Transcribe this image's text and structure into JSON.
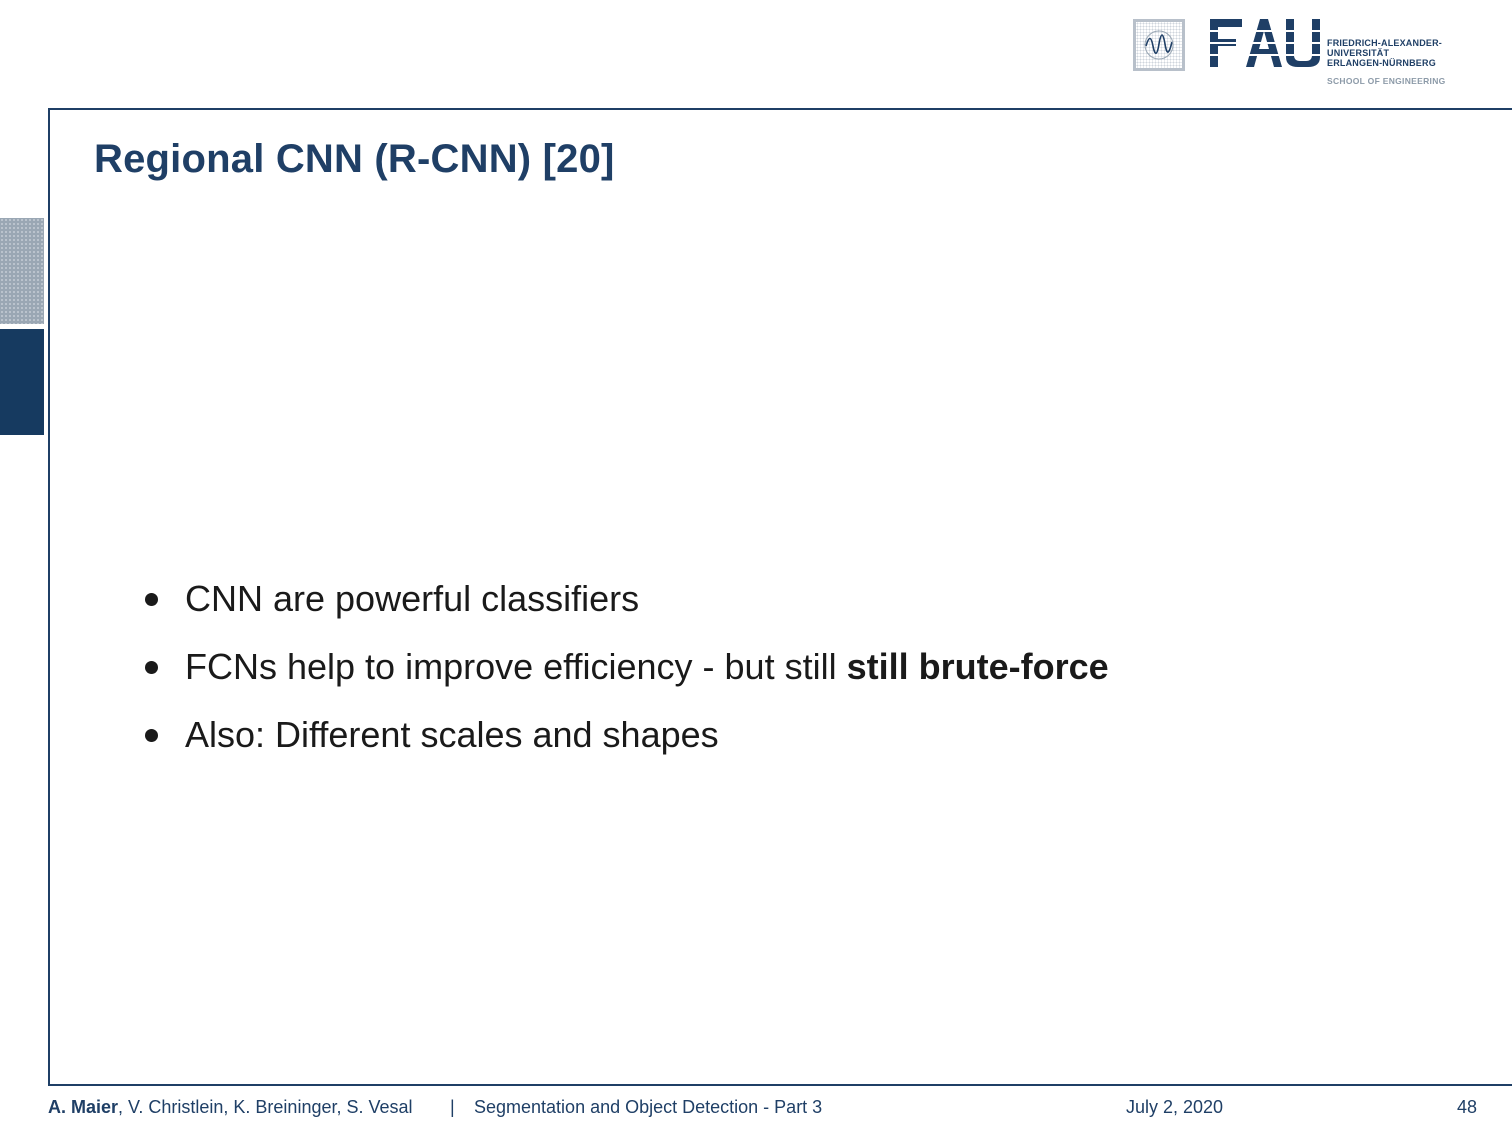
{
  "slide": {
    "title": "Regional CNN (R-CNN) [20]",
    "bullets": [
      {
        "text": "CNN are powerful classifiers",
        "bold": ""
      },
      {
        "text": "FCNs help to improve efficiency - but still ",
        "bold": "still brute-force"
      },
      {
        "text": "Also: Different scales and shapes",
        "bold": ""
      }
    ]
  },
  "logo": {
    "letters": "FAU",
    "university_line1": "FRIEDRICH-ALEXANDER-",
    "university_line2": "UNIVERSITÄT",
    "university_line3": "ERLANGEN-NÜRNBERG",
    "school": "SCHOOL OF ENGINEERING"
  },
  "footer": {
    "lead_author": "A. Maier",
    "other_authors": ", V. Christlein, K. Breininger, S. Vesal",
    "separator": "|",
    "talk_title": "Segmentation and Object Detection - Part 3",
    "date": "July 2, 2020",
    "page": "48"
  },
  "colors": {
    "accent": "#1f3f66",
    "side_dark": "#163a60",
    "side_light": "#9aa7b4"
  }
}
